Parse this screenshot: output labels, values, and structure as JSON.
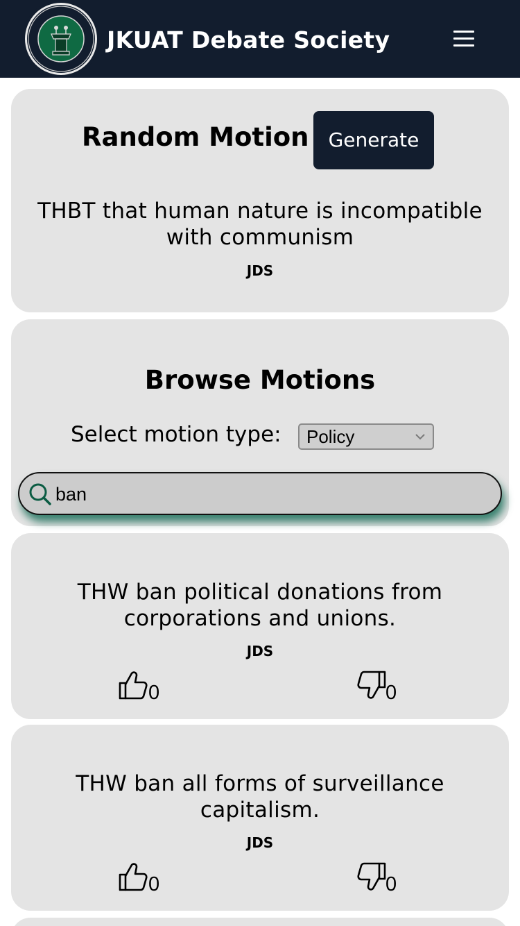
{
  "header": {
    "title": "JKUAT Debate Society",
    "logo_text": "JKUAT DEBATE SOCIETY",
    "menu_icon": "hamburger-menu-icon",
    "background": "#121d2e"
  },
  "random_motion": {
    "title": "Random Motion",
    "generate_label": "Generate",
    "motion": "THBT that human nature is incompatible with communism",
    "source": "JDS"
  },
  "browse": {
    "title": "Browse Motions",
    "select_label": "Select motion type:",
    "select_value": "Policy",
    "search_value": "ban",
    "search_icon": "search-icon",
    "accent": "#006048"
  },
  "motions": [
    {
      "text": "THW ban political donations from corporations and unions.",
      "source": "JDS",
      "likes": "0",
      "dislikes": "0"
    },
    {
      "text": "THW ban all forms of surveillance capitalism.",
      "source": "JDS",
      "likes": "0",
      "dislikes": "0"
    }
  ]
}
